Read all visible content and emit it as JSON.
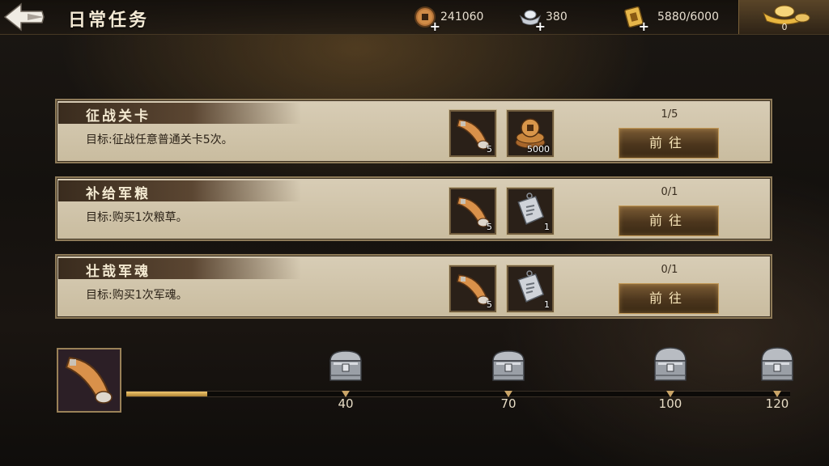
{
  "header": {
    "title": "日常任务",
    "copper": "241060",
    "silver": "380",
    "stamina": "5880/6000",
    "gold": "0"
  },
  "tasks": [
    {
      "name": "征战关卡",
      "goal": "目标:征战任意普通关卡5次。",
      "progress": "1/5",
      "button": "前往",
      "rewards": [
        {
          "icon": "horn-icon",
          "qty": "5"
        },
        {
          "icon": "coins-icon",
          "qty": "5000"
        }
      ]
    },
    {
      "name": "补给军粮",
      "goal": "目标:购买1次粮草。",
      "progress": "0/1",
      "button": "前往",
      "rewards": [
        {
          "icon": "horn-icon",
          "qty": "5"
        },
        {
          "icon": "silver-token-icon",
          "qty": "1"
        }
      ]
    },
    {
      "name": "壮哉军魂",
      "goal": "目标:购买1次军魂。",
      "progress": "0/1",
      "button": "前往",
      "rewards": [
        {
          "icon": "horn-icon",
          "qty": "5"
        },
        {
          "icon": "silver-token-icon",
          "qty": "1"
        }
      ]
    }
  ],
  "activity": {
    "current": 5,
    "max": 120,
    "milestones": [
      "40",
      "70",
      "100",
      "120"
    ]
  }
}
